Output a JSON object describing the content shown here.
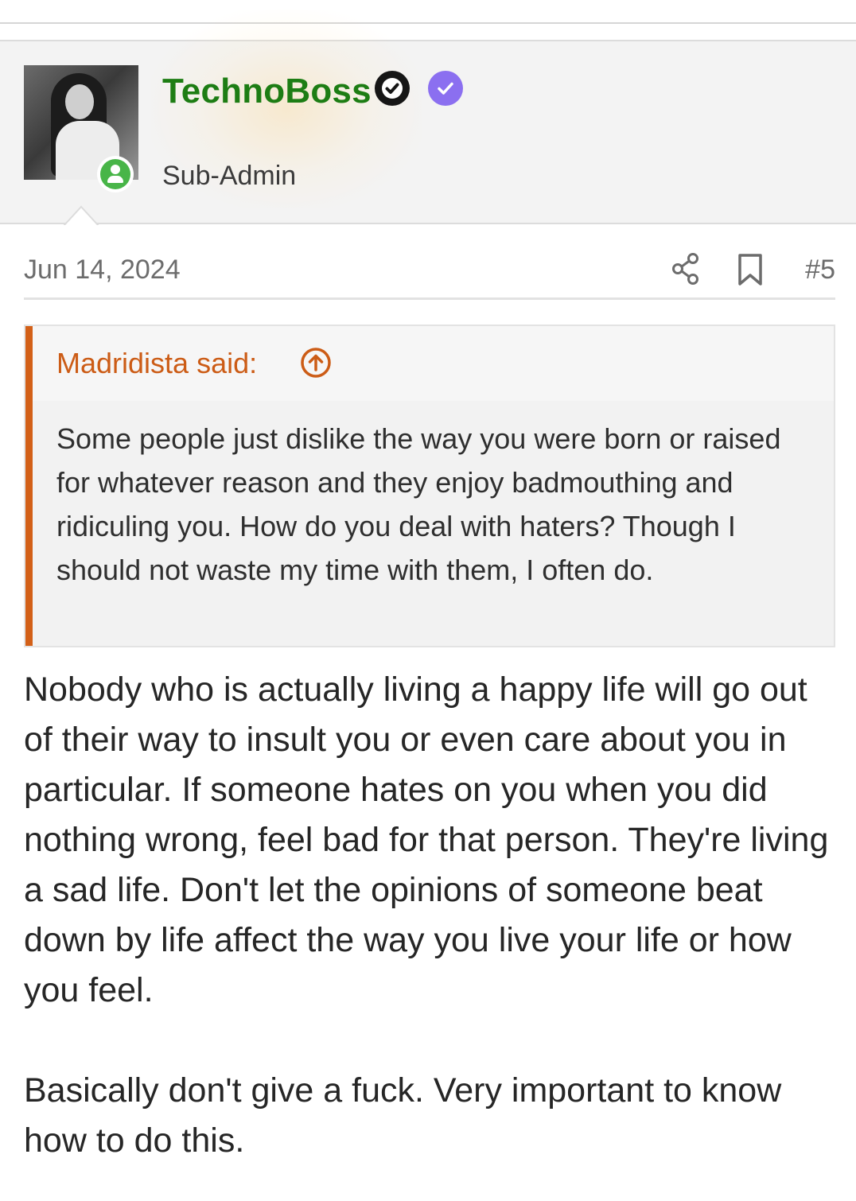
{
  "post": {
    "author": {
      "username": "TechnoBoss",
      "title": "Sub-Admin",
      "online": true
    },
    "date": "Jun 14, 2024",
    "number": "#5",
    "quote": {
      "author_label": "Madridista said:",
      "text": "Some people just dislike the way you were born or raised for whatever reason and they enjoy badmouthing and ridiculing you. How do you deal with haters? Though I should not waste my time with them, I often do."
    },
    "body": {
      "paragraph_1": "Nobody who is actually living a happy life will go out of their way to insult you or even care about you in particular. If someone hates on you when you did nothing wrong, feel bad for that person. They're living a sad life. Don't let the opinions of someone beat down by life affect the way you live your life or how you feel.",
      "paragraph_2": "Basically don't give a fuck. Very important to know how to do this."
    }
  },
  "icons": {
    "avatar": "user-avatar",
    "online": "online-status-icon",
    "verified_dark": "verified-badge-icon",
    "verified_purple": "verified-check-icon",
    "share": "share-icon",
    "bookmark": "bookmark-icon",
    "quote_jump": "arrow-up-circle-icon"
  },
  "colors": {
    "username": "#1d7d14",
    "quote_accent": "#d36018",
    "online": "#48b548",
    "verified_purple": "#8b6ff0"
  }
}
